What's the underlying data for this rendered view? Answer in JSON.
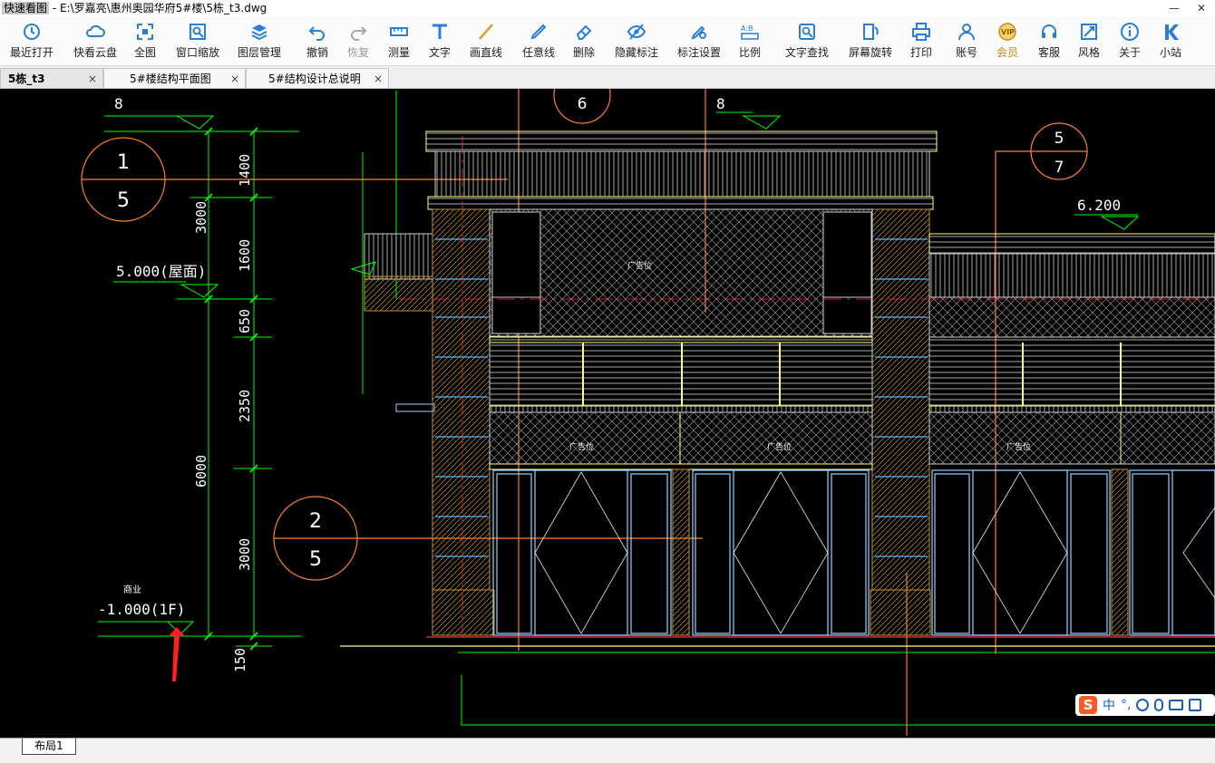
{
  "window": {
    "app_name": "快速看图",
    "file_path": " - E:\\罗嘉亮\\惠州奥园华府5#楼\\5栋_t3.dwg",
    "minimize_label": "—",
    "close_label": "✕"
  },
  "toolbar": {
    "items": [
      {
        "label": "最近打开",
        "icon": "clock-icon"
      },
      {
        "label": "快看云盘",
        "icon": "cloud-icon"
      },
      {
        "label": "全图",
        "icon": "fit-all-icon"
      },
      {
        "label": "窗口缩放",
        "icon": "window-zoom-icon"
      },
      {
        "label": "图层管理",
        "icon": "layers-icon"
      },
      {
        "label": "撤销",
        "icon": "undo-icon"
      },
      {
        "label": "恢复",
        "icon": "redo-icon"
      },
      {
        "label": "测量",
        "icon": "measure-icon"
      },
      {
        "label": "文字",
        "icon": "text-icon"
      },
      {
        "label": "画直线",
        "icon": "line-icon"
      },
      {
        "label": "任意线",
        "icon": "freehand-icon"
      },
      {
        "label": "删除",
        "icon": "eraser-icon"
      },
      {
        "label": "隐藏标注",
        "icon": "hide-annotation-icon"
      },
      {
        "label": "标注设置",
        "icon": "annotation-settings-icon"
      },
      {
        "label": "比例",
        "icon": "scale-icon"
      },
      {
        "label": "文字查找",
        "icon": "text-search-icon"
      },
      {
        "label": "屏幕旋转",
        "icon": "rotate-screen-icon"
      },
      {
        "label": "打印",
        "icon": "print-icon"
      },
      {
        "label": "账号",
        "icon": "account-icon"
      },
      {
        "label": "会员",
        "icon": "vip-icon"
      },
      {
        "label": "客服",
        "icon": "headset-icon"
      },
      {
        "label": "风格",
        "icon": "style-icon"
      },
      {
        "label": "关于",
        "icon": "info-icon"
      },
      {
        "label": "小站",
        "icon": "k-logo-icon"
      }
    ]
  },
  "tabs": [
    {
      "label": "5栋_t3",
      "active": true
    },
    {
      "label": "5#楼结构平面图",
      "active": false
    },
    {
      "label": "5#结构设计总说明",
      "active": false
    }
  ],
  "tab_close": "×",
  "drawing": {
    "axis_marks": [
      "8",
      "8"
    ],
    "section_callouts": [
      {
        "top": "1",
        "bottom": "5"
      },
      {
        "top": "2",
        "bottom": "5"
      },
      {
        "top": "5",
        "bottom": "7"
      },
      {
        "top": "6",
        "bottom": ""
      }
    ],
    "elevations": {
      "roof": "5.000(屋面)",
      "right": "6.200",
      "first_floor": "-1.000(1F)",
      "shop_label": "商业"
    },
    "dims_inner": [
      "1400",
      "1600",
      "650",
      "2350",
      "3000",
      "150"
    ],
    "dims_outer": [
      "3000",
      "6000"
    ],
    "sign_labels": [
      "广告位",
      "广告位",
      "广告位",
      "广告位"
    ]
  },
  "layout_tab": "布局1",
  "ime": {
    "lang": "中",
    "punct": "°,"
  },
  "colors": {
    "green": "#00ff00",
    "orange": "#ff7f27",
    "yellow": "#ffff80",
    "cyan": "#5fb6ff",
    "red": "#ff2020"
  }
}
